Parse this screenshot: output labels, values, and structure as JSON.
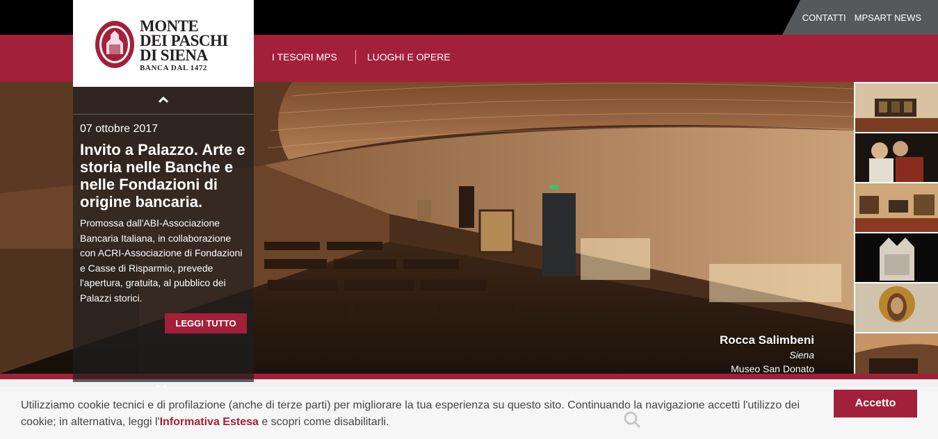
{
  "brand": {
    "lines": [
      "MONTE",
      "DEI PASCHI",
      "DI SIENA"
    ],
    "tagline": "BANCA DAL 1472",
    "colors": {
      "accent": "#a3203b",
      "topbar": "#000000",
      "topbar_tab": "#55595c"
    }
  },
  "top_links": [
    {
      "label": "CONTATTI"
    },
    {
      "label": "MPSART NEWS"
    }
  ],
  "nav": [
    {
      "label": "I TESORI MPS"
    },
    {
      "label": "LUOGHI E OPERE"
    }
  ],
  "news": {
    "date": "07 ottobre 2017",
    "title": "Invito a Palazzo. Arte e storia nelle Banche e nelle Fondazioni di origine bancaria.",
    "body": "Promossa dall'ABI-Associazione Bancaria Italiana, in collaborazione con ACRI-Associazione di Fondazioni e Casse di Risparmio, prevede l'apertura, gratuita, al pubblico  dei Palazzi storici.",
    "button": "LEGGI TUTTO",
    "up_icon": "chevron-up-icon",
    "down_icon": "chevron-down-icon"
  },
  "slide": {
    "title": "Rocca Salimbeni",
    "city": "Siena",
    "museum": "Museo San Donato"
  },
  "thumbnails": [
    {
      "subject": "gallery-room"
    },
    {
      "subject": "painting-figures"
    },
    {
      "subject": "gallery-room-red"
    },
    {
      "subject": "marble-relief"
    },
    {
      "subject": "christ-mosaic"
    },
    {
      "subject": "museum-hall"
    }
  ],
  "cookie": {
    "text_before": "Utilizziamo cookie tecnici e di profilazione (anche di terze parti) per migliorare la tua esperienza su questo sito. Continuando la navigazione accetti l'utilizzo dei cookie; in alternativa, leggi l'",
    "link": "Informativa Estesa",
    "text_after": " e scopri come disabilitarli.",
    "accept": "Accetto",
    "search_icon": "search-icon"
  }
}
